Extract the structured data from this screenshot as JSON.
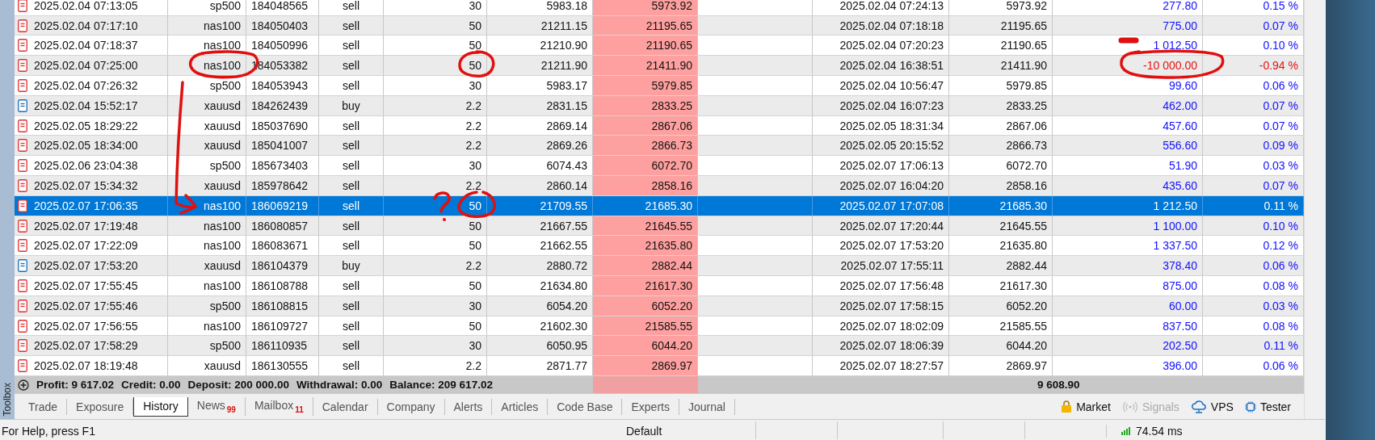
{
  "toolbox_label": "Toolbox",
  "rows": [
    {
      "kind": "sell",
      "open_time": "2025.02.04 07:13:05",
      "symbol": "sp500",
      "ticket": "184048565",
      "type": "sell",
      "volume": "30",
      "open_price": "5983.18",
      "column_7": "5973.92",
      "close_time": "2025.02.04 07:24:13",
      "close_price": "5973.92",
      "profit": "277.80",
      "change": "0.15 %",
      "negative": false,
      "selected": false
    },
    {
      "kind": "sell",
      "open_time": "2025.02.04 07:17:10",
      "symbol": "nas100",
      "ticket": "184050403",
      "type": "sell",
      "volume": "50",
      "open_price": "21211.15",
      "column_7": "21195.65",
      "close_time": "2025.02.04 07:18:18",
      "close_price": "21195.65",
      "profit": "775.00",
      "change": "0.07 %",
      "negative": false,
      "selected": false
    },
    {
      "kind": "sell",
      "open_time": "2025.02.04 07:18:37",
      "symbol": "nas100",
      "ticket": "184050996",
      "type": "sell",
      "volume": "50",
      "open_price": "21210.90",
      "column_7": "21190.65",
      "close_time": "2025.02.04 07:20:23",
      "close_price": "21190.65",
      "profit": "1 012.50",
      "change": "0.10 %",
      "negative": false,
      "selected": false
    },
    {
      "kind": "sell",
      "open_time": "2025.02.04 07:25:00",
      "symbol": "nas100",
      "ticket": "184053382",
      "type": "sell",
      "volume": "50",
      "open_price": "21211.90",
      "column_7": "21411.90",
      "close_time": "2025.02.04 16:38:51",
      "close_price": "21411.90",
      "profit": "-10 000.00",
      "change": "-0.94 %",
      "negative": true,
      "selected": false
    },
    {
      "kind": "sell",
      "open_time": "2025.02.04 07:26:32",
      "symbol": "sp500",
      "ticket": "184053943",
      "type": "sell",
      "volume": "30",
      "open_price": "5983.17",
      "column_7": "5979.85",
      "close_time": "2025.02.04 10:56:47",
      "close_price": "5979.85",
      "profit": "99.60",
      "change": "0.06 %",
      "negative": false,
      "selected": false
    },
    {
      "kind": "buy",
      "open_time": "2025.02.04 15:52:17",
      "symbol": "xauusd",
      "ticket": "184262439",
      "type": "buy",
      "volume": "2.2",
      "open_price": "2831.15",
      "column_7": "2833.25",
      "close_time": "2025.02.04 16:07:23",
      "close_price": "2833.25",
      "profit": "462.00",
      "change": "0.07 %",
      "negative": false,
      "selected": false
    },
    {
      "kind": "sell",
      "open_time": "2025.02.05 18:29:22",
      "symbol": "xauusd",
      "ticket": "185037690",
      "type": "sell",
      "volume": "2.2",
      "open_price": "2869.14",
      "column_7": "2867.06",
      "close_time": "2025.02.05 18:31:34",
      "close_price": "2867.06",
      "profit": "457.60",
      "change": "0.07 %",
      "negative": false,
      "selected": false
    },
    {
      "kind": "sell",
      "open_time": "2025.02.05 18:34:00",
      "symbol": "xauusd",
      "ticket": "185041007",
      "type": "sell",
      "volume": "2.2",
      "open_price": "2869.26",
      "column_7": "2866.73",
      "close_time": "2025.02.05 20:15:52",
      "close_price": "2866.73",
      "profit": "556.60",
      "change": "0.09 %",
      "negative": false,
      "selected": false
    },
    {
      "kind": "sell",
      "open_time": "2025.02.06 23:04:38",
      "symbol": "sp500",
      "ticket": "185673403",
      "type": "sell",
      "volume": "30",
      "open_price": "6074.43",
      "column_7": "6072.70",
      "close_time": "2025.02.07 17:06:13",
      "close_price": "6072.70",
      "profit": "51.90",
      "change": "0.03 %",
      "negative": false,
      "selected": false
    },
    {
      "kind": "sell",
      "open_time": "2025.02.07 15:34:32",
      "symbol": "xauusd",
      "ticket": "185978642",
      "type": "sell",
      "volume": "2.2",
      "open_price": "2860.14",
      "column_7": "2858.16",
      "close_time": "2025.02.07 16:04:20",
      "close_price": "2858.16",
      "profit": "435.60",
      "change": "0.07 %",
      "negative": false,
      "selected": false
    },
    {
      "kind": "sell",
      "open_time": "2025.02.07 17:06:35",
      "symbol": "nas100",
      "ticket": "186069219",
      "type": "sell",
      "volume": "50",
      "open_price": "21709.55",
      "column_7": "21685.30",
      "close_time": "2025.02.07 17:07:08",
      "close_price": "21685.30",
      "profit": "1 212.50",
      "change": "0.11 %",
      "negative": false,
      "selected": true
    },
    {
      "kind": "sell",
      "open_time": "2025.02.07 17:19:48",
      "symbol": "nas100",
      "ticket": "186080857",
      "type": "sell",
      "volume": "50",
      "open_price": "21667.55",
      "column_7": "21645.55",
      "close_time": "2025.02.07 17:20:44",
      "close_price": "21645.55",
      "profit": "1 100.00",
      "change": "0.10 %",
      "negative": false,
      "selected": false
    },
    {
      "kind": "sell",
      "open_time": "2025.02.07 17:22:09",
      "symbol": "nas100",
      "ticket": "186083671",
      "type": "sell",
      "volume": "50",
      "open_price": "21662.55",
      "column_7": "21635.80",
      "close_time": "2025.02.07 17:53:20",
      "close_price": "21635.80",
      "profit": "1 337.50",
      "change": "0.12 %",
      "negative": false,
      "selected": false
    },
    {
      "kind": "buy",
      "open_time": "2025.02.07 17:53:20",
      "symbol": "xauusd",
      "ticket": "186104379",
      "type": "buy",
      "volume": "2.2",
      "open_price": "2880.72",
      "column_7": "2882.44",
      "close_time": "2025.02.07 17:55:11",
      "close_price": "2882.44",
      "profit": "378.40",
      "change": "0.06 %",
      "negative": false,
      "selected": false
    },
    {
      "kind": "sell",
      "open_time": "2025.02.07 17:55:45",
      "symbol": "nas100",
      "ticket": "186108788",
      "type": "sell",
      "volume": "50",
      "open_price": "21634.80",
      "column_7": "21617.30",
      "close_time": "2025.02.07 17:56:48",
      "close_price": "21617.30",
      "profit": "875.00",
      "change": "0.08 %",
      "negative": false,
      "selected": false
    },
    {
      "kind": "sell",
      "open_time": "2025.02.07 17:55:46",
      "symbol": "sp500",
      "ticket": "186108815",
      "type": "sell",
      "volume": "30",
      "open_price": "6054.20",
      "column_7": "6052.20",
      "close_time": "2025.02.07 17:58:15",
      "close_price": "6052.20",
      "profit": "60.00",
      "change": "0.03 %",
      "negative": false,
      "selected": false
    },
    {
      "kind": "sell",
      "open_time": "2025.02.07 17:56:55",
      "symbol": "nas100",
      "ticket": "186109727",
      "type": "sell",
      "volume": "50",
      "open_price": "21602.30",
      "column_7": "21585.55",
      "close_time": "2025.02.07 18:02:09",
      "close_price": "21585.55",
      "profit": "837.50",
      "change": "0.08 %",
      "negative": false,
      "selected": false
    },
    {
      "kind": "sell",
      "open_time": "2025.02.07 17:58:29",
      "symbol": "sp500",
      "ticket": "186110935",
      "type": "sell",
      "volume": "30",
      "open_price": "6050.95",
      "column_7": "6044.20",
      "close_time": "2025.02.07 18:06:39",
      "close_price": "6044.20",
      "profit": "202.50",
      "change": "0.11 %",
      "negative": false,
      "selected": false
    },
    {
      "kind": "sell",
      "open_time": "2025.02.07 18:19:48",
      "symbol": "xauusd",
      "ticket": "186130555",
      "type": "sell",
      "volume": "2.2",
      "open_price": "2871.77",
      "column_7": "2869.97",
      "close_time": "2025.02.07 18:27:57",
      "close_price": "2869.97",
      "profit": "396.00",
      "change": "0.06 %",
      "negative": false,
      "selected": false
    }
  ],
  "summary": {
    "items": [
      "Profit: 9 617.02",
      "Credit: 0.00",
      "Deposit: 200 000.00",
      "Withdrawal: 0.00",
      "Balance: 209 617.02"
    ],
    "profit_total": "9 608.90"
  },
  "tabs": [
    {
      "label": "Trade",
      "selected": false
    },
    {
      "label": "Exposure",
      "selected": false
    },
    {
      "label": "History",
      "selected": true
    },
    {
      "label": "News",
      "badge": "99",
      "selected": false
    },
    {
      "label": "Mailbox",
      "badge": "11",
      "selected": false
    },
    {
      "label": "Calendar",
      "selected": false
    },
    {
      "label": "Company",
      "selected": false
    },
    {
      "label": "Alerts",
      "selected": false
    },
    {
      "label": "Articles",
      "selected": false
    },
    {
      "label": "Code Base",
      "selected": false
    },
    {
      "label": "Experts",
      "selected": false
    },
    {
      "label": "Journal",
      "selected": false
    }
  ],
  "services": [
    {
      "kind": "market",
      "label": "Market",
      "disabled": false
    },
    {
      "kind": "signals",
      "label": "Signals",
      "disabled": true
    },
    {
      "kind": "vps",
      "label": "VPS",
      "disabled": false
    },
    {
      "kind": "tester",
      "label": "Tester",
      "disabled": false
    }
  ],
  "status_bar": {
    "help": "For Help, press F1",
    "profile": "Default",
    "ping": "74.54 ms"
  }
}
